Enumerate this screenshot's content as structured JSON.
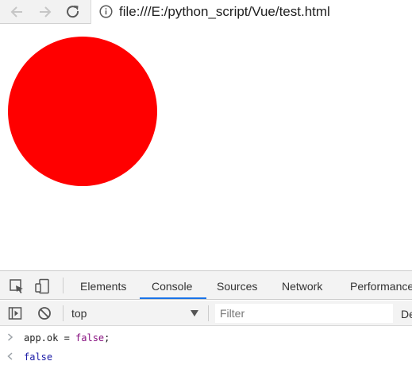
{
  "browser": {
    "url": "file:///E:/python_script/Vue/test.html"
  },
  "page": {
    "circle_color": "#ff0000"
  },
  "devtools": {
    "tabs": [
      "Elements",
      "Console",
      "Sources",
      "Network",
      "Performance"
    ],
    "active_tab": "Console",
    "accent_color": "#1a73e8",
    "console": {
      "context": "top",
      "filter_placeholder": "Filter",
      "levels_label": "De",
      "input": {
        "prompt": ">",
        "text_before": "app.ok = ",
        "keyword": "false",
        "text_after": ";"
      },
      "output": {
        "prompt": "<",
        "text": "false"
      }
    }
  }
}
